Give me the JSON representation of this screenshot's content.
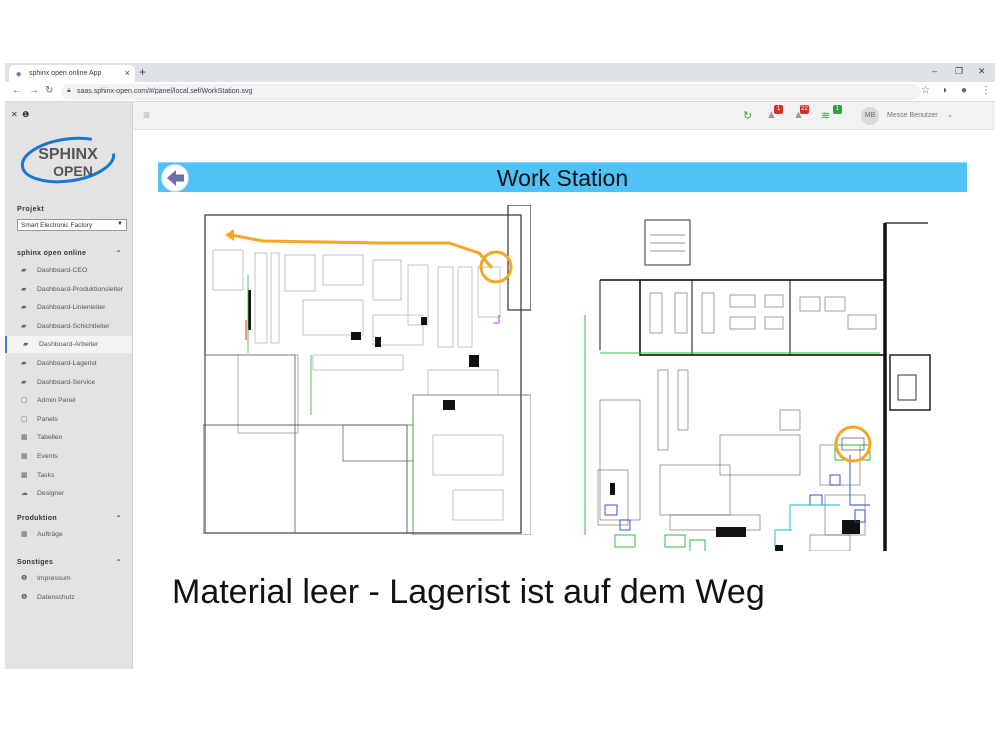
{
  "browser": {
    "tab_title": "sphinx open online App",
    "url": "saas.sphinx-open.com/#/panel/local.sef/WorkStation.svg"
  },
  "sidebar": {
    "logo_top": "SPHINX",
    "logo_bottom": "OPEN",
    "project_label": "Projekt",
    "project_value": "Smart Electronic Factory",
    "section_main": "sphinx open online",
    "items": [
      {
        "label": "Dashboard-CEO",
        "icon": "chart-icon"
      },
      {
        "label": "Dashboard-Produktionsleiter",
        "icon": "chart-icon"
      },
      {
        "label": "Dashboard-Linienleiter",
        "icon": "chart-icon"
      },
      {
        "label": "Dashboard-Schichtleiter",
        "icon": "chart-icon"
      },
      {
        "label": "Dashboard-Arbeiter",
        "icon": "chart-icon"
      },
      {
        "label": "Dashboard-Lagerist",
        "icon": "chart-icon"
      },
      {
        "label": "Dashboard-Service",
        "icon": "chart-icon"
      },
      {
        "label": "Admin Panel",
        "icon": "panel-icon"
      },
      {
        "label": "Panels",
        "icon": "panel-icon"
      },
      {
        "label": "Tabellen",
        "icon": "table-icon"
      },
      {
        "label": "Events",
        "icon": "table-icon"
      },
      {
        "label": "Tasks",
        "icon": "table-icon"
      },
      {
        "label": "Designer",
        "icon": "cloud-icon"
      }
    ],
    "section_production": "Produktion",
    "production_items": [
      {
        "label": "Aufträge",
        "icon": "table-icon"
      }
    ],
    "section_other": "Sonstiges",
    "other_items": [
      {
        "label": "Impressum",
        "icon": "info-icon"
      },
      {
        "label": "Datenschutz",
        "icon": "info-icon"
      }
    ]
  },
  "appbar": {
    "badge_alerts": "1",
    "badge_messages": "22",
    "badge_signal": "1",
    "avatar_initials": "MB",
    "username": "Messe Benutzer"
  },
  "main": {
    "banner_title": "Work Station",
    "status_message": "Material leer - Lagerist ist auf dem Weg"
  },
  "colors": {
    "banner": "#4fc3f7",
    "route": "#f5a623",
    "badge_red": "#d32f2f",
    "badge_green": "#2e9e4a"
  }
}
